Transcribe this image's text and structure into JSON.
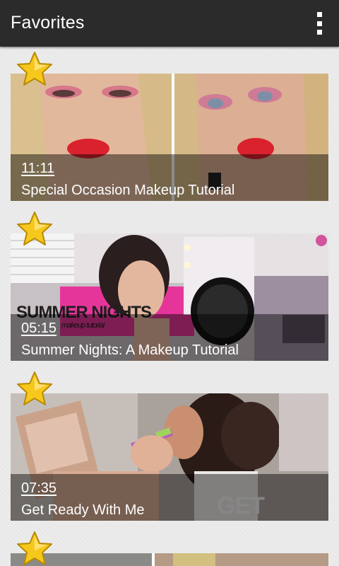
{
  "appbar": {
    "title": "Favorites",
    "menu_icon": "overflow-menu-icon"
  },
  "colors": {
    "appbar": "#2b2b2b",
    "background": "#e9e9e9",
    "star": "#f7c81c",
    "lipstick": "#d9222e"
  },
  "videos": [
    {
      "duration": "11:11",
      "title": "Special Occasion Makeup Tutorial",
      "favorite_icon": "star-icon"
    },
    {
      "duration": "05:15",
      "title": "Summer Nights: A Makeup Tutorial",
      "favorite_icon": "star-icon",
      "thumb_text": "SUMMER NIGHTS",
      "thumb_subtext": "makeup tutorial"
    },
    {
      "duration": "07:35",
      "title": "Get Ready With Me",
      "favorite_icon": "star-icon",
      "thumb_text": "GET READY"
    },
    {
      "duration": "",
      "title": "",
      "favorite_icon": "star-icon"
    }
  ]
}
